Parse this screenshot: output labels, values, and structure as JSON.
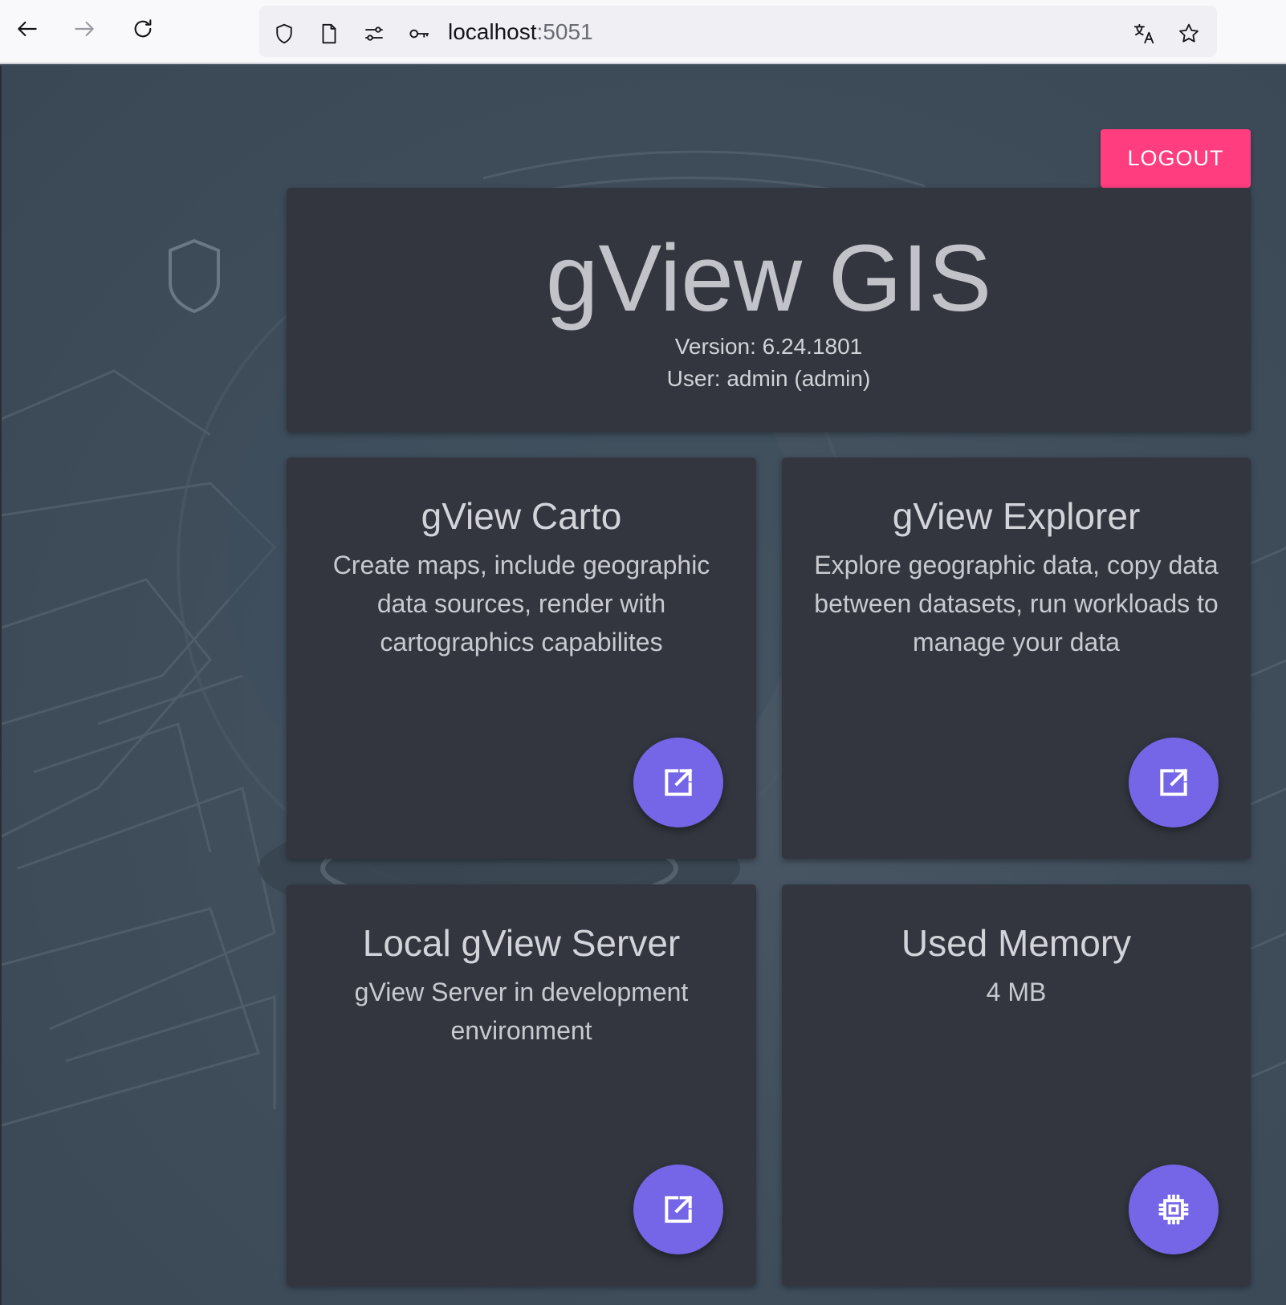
{
  "browser": {
    "url_host": "localhost",
    "url_port": ":5051",
    "icons": [
      "back-arrow-icon",
      "forward-arrow-icon",
      "reload-icon",
      "shield-icon",
      "page-icon",
      "permissions-icon",
      "key-icon",
      "translate-icon",
      "bookmark-star-icon"
    ]
  },
  "header": {
    "logout_label": "LOGOUT",
    "title": "gView GIS",
    "version": "Version: 6.24.1801",
    "user": "User: admin (admin)"
  },
  "tiles": [
    {
      "title": "gView Carto",
      "description": "Create maps, include geographic data sources, render with cartographics capabilites",
      "action_icon": "open-in-new-icon"
    },
    {
      "title": "gView Explorer",
      "description": "Explore geographic data, copy data between datasets, run workloads to manage your data",
      "action_icon": "open-in-new-icon"
    },
    {
      "title": "Local gView Server",
      "description": "gView Server in development environment",
      "action_icon": "open-in-new-icon"
    },
    {
      "title": "Used Memory",
      "description": "4 MB",
      "action_icon": "memory-chip-icon"
    }
  ],
  "colors": {
    "accent": "#7466e6",
    "logout": "#ff3d7f",
    "card": "#33363f",
    "background": "#3f4d5b"
  }
}
